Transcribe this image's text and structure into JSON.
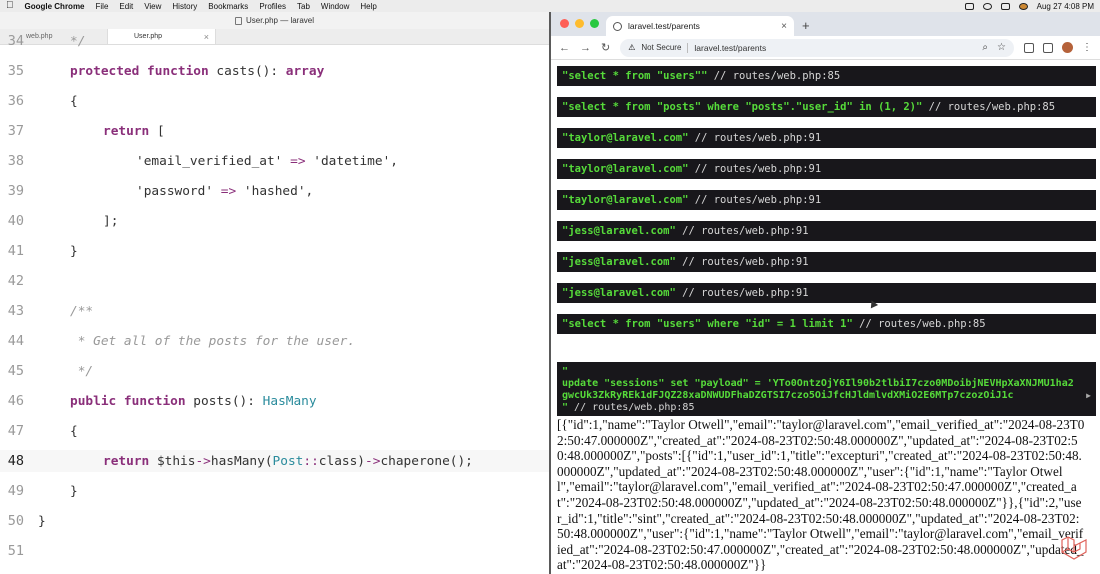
{
  "menubar": {
    "app": "Google Chrome",
    "items": [
      "File",
      "Edit",
      "View",
      "History",
      "Bookmarks",
      "Profiles",
      "Tab",
      "Window",
      "Help"
    ],
    "clock": "Aug 27  4:08 PM"
  },
  "editor": {
    "window_title": "User.php — laravel",
    "tabs": [
      {
        "label": "web.php",
        "active": false
      },
      {
        "label": "User.php",
        "active": true
      }
    ],
    "lines": [
      {
        "n": "34",
        "html": "<span class='cm'>*/</span>",
        "indent": 1
      },
      {
        "n": "35",
        "html": "<span class='kw'>protected function</span> <span class='fn'>casts</span>(): <span class='kw'>array</span>",
        "indent": 1
      },
      {
        "n": "36",
        "html": "{",
        "indent": 1
      },
      {
        "n": "37",
        "html": "<span class='kw'>return</span> [",
        "indent": 2
      },
      {
        "n": "38",
        "html": "<span class='st'>'email_verified_at'</span> <span class='ar'>=></span> <span class='st'>'datetime'</span>,",
        "indent": 3
      },
      {
        "n": "39",
        "html": "<span class='st'>'password'</span> <span class='ar'>=></span> <span class='st'>'hashed'</span>,",
        "indent": 3
      },
      {
        "n": "40",
        "html": "];",
        "indent": 2
      },
      {
        "n": "41",
        "html": "}",
        "indent": 1
      },
      {
        "n": "42",
        "html": "",
        "indent": 1
      },
      {
        "n": "43",
        "html": "<span class='cm'>/**</span>",
        "indent": 1
      },
      {
        "n": "44",
        "html": "<span class='cm'> * Get all of the posts for the user.</span>",
        "indent": 1
      },
      {
        "n": "45",
        "html": "<span class='cm'> */</span>",
        "indent": 1
      },
      {
        "n": "46",
        "html": "<span class='kw'>public function</span> <span class='fn'>posts</span>(): <span class='ty'>HasMany</span>",
        "indent": 1
      },
      {
        "n": "47",
        "html": "{",
        "indent": 1
      },
      {
        "n": "48",
        "html": "<span class='kw'>return</span> $this<span class='ar'>-></span>hasMany(<span class='ty'>Post</span><span class='ar'>::</span>class)<span class='ar'>-></span>chaperone();",
        "indent": 2,
        "current": true
      },
      {
        "n": "49",
        "html": "}",
        "indent": 1
      },
      {
        "n": "50",
        "html": "}",
        "indent": 0
      },
      {
        "n": "51",
        "html": "",
        "indent": 0
      }
    ]
  },
  "browser": {
    "tab_title": "laravel.test/parents",
    "not_secure": "Not Secure",
    "url": "laravel.test/parents",
    "dumps": [
      {
        "q": "\"select * from \"users\"\"",
        "c": " // routes/web.php:85"
      },
      {
        "q": "\"select * from \"posts\" where \"posts\".\"user_id\" in (1, 2)\"",
        "c": " // routes/web.php:85"
      },
      {
        "q": "\"taylor@laravel.com\"",
        "c": " // routes/web.php:91"
      },
      {
        "q": "\"taylor@laravel.com\"",
        "c": " // routes/web.php:91"
      },
      {
        "q": "\"taylor@laravel.com\"",
        "c": " // routes/web.php:91"
      },
      {
        "q": "\"jess@laravel.com\"",
        "c": " // routes/web.php:91"
      },
      {
        "q": "\"jess@laravel.com\"",
        "c": " // routes/web.php:91"
      },
      {
        "q": "\"jess@laravel.com\"",
        "c": " // routes/web.php:91"
      },
      {
        "q": "\"select * from \"users\" where \"id\" = 1 limit 1\"",
        "c": " // routes/web.php:85"
      }
    ],
    "big_dump": {
      "open": "\"",
      "q": "update \"sessions\" set \"payload\" = 'YTo0OntzOjY6Il90b2tlbiI7czo0MDoibjNEVHpXaXNJMU1ha2gwcUk3ZkRyREk1dFJQZ28xaDNWUDFhaDZGTSI7czo5OiJfcHJldmlvdXMiO2E6MTp7czozOiJ1c",
      "close": "\"",
      "c": " // routes/web.php:85"
    },
    "json_output": "[{\"id\":1,\"name\":\"Taylor Otwell\",\"email\":\"taylor@laravel.com\",\"email_verified_at\":\"2024-08-23T02:50:47.000000Z\",\"created_at\":\"2024-08-23T02:50:48.000000Z\",\"updated_at\":\"2024-08-23T02:50:48.000000Z\",\"posts\":[{\"id\":1,\"user_id\":1,\"title\":\"excepturi\",\"created_at\":\"2024-08-23T02:50:48.000000Z\",\"updated_at\":\"2024-08-23T02:50:48.000000Z\",\"user\":{\"id\":1,\"name\":\"Taylor Otwell\",\"email\":\"taylor@laravel.com\",\"email_verified_at\":\"2024-08-23T02:50:47.000000Z\",\"created_at\":\"2024-08-23T02:50:48.000000Z\",\"updated_at\":\"2024-08-23T02:50:48.000000Z\"}},{\"id\":2,\"user_id\":1,\"title\":\"sint\",\"created_at\":\"2024-08-23T02:50:48.000000Z\",\"updated_at\":\"2024-08-23T02:50:48.000000Z\",\"user\":{\"id\":1,\"name\":\"Taylor Otwell\",\"email\":\"taylor@laravel.com\",\"email_verified_at\":\"2024-08-23T02:50:47.000000Z\",\"created_at\":\"2024-08-23T02:50:48.000000Z\",\"updated_at\":\"2024-08-23T02:50:48.000000Z\"}}"
  },
  "colors": {
    "dump_bg": "#18171b",
    "dump_query": "#56db3a",
    "keyword": "#8a2f7a",
    "type": "#2a8b9c"
  }
}
